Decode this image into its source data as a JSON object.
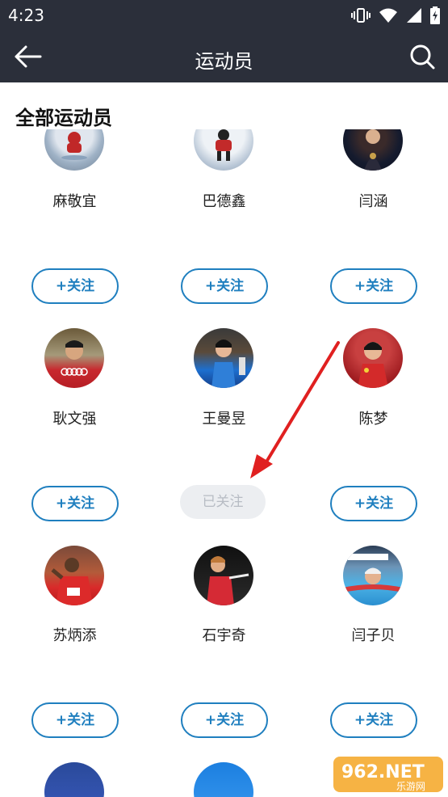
{
  "status": {
    "time": "4:23"
  },
  "header": {
    "title": "运动员"
  },
  "section": {
    "title": "全部运动员"
  },
  "athletes": [
    {
      "name": "麻敬宜",
      "button": "+关注",
      "followed": false
    },
    {
      "name": "巴德鑫",
      "button": "+关注",
      "followed": false
    },
    {
      "name": "闫涵",
      "button": "+关注",
      "followed": false
    },
    {
      "name": "耿文强",
      "button": "+关注",
      "followed": false
    },
    {
      "name": "王曼昱",
      "button": "已关注",
      "followed": true
    },
    {
      "name": "陈梦",
      "button": "+关注",
      "followed": false
    },
    {
      "name": "苏炳添",
      "button": "+关注",
      "followed": false
    },
    {
      "name": "石宇奇",
      "button": "+关注",
      "followed": false
    },
    {
      "name": "闫子贝",
      "button": "+关注",
      "followed": false
    }
  ],
  "watermark": {
    "text": "962.NET",
    "sub": "乐游网"
  },
  "colors": {
    "header_bg": "#2b2f3a",
    "accent": "#1f7fbf",
    "arrow": "#e02020"
  }
}
